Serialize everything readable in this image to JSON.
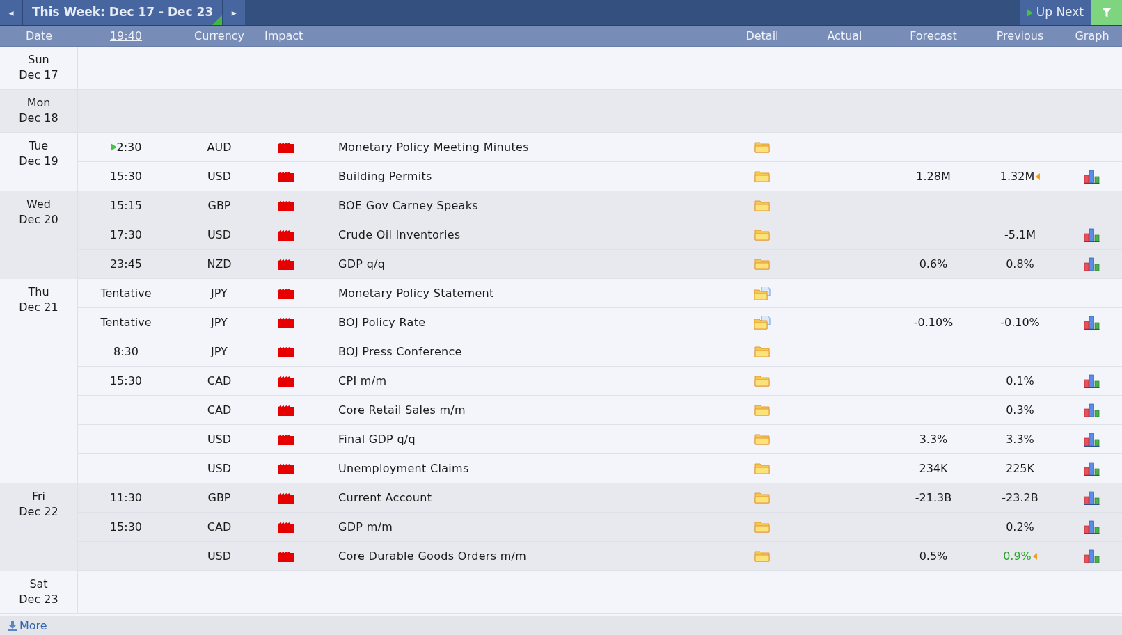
{
  "toolbar": {
    "prev_label": "◂",
    "week_label": "This Week: Dec 17 - Dec 23",
    "next_label": "▸",
    "up_next_label": "Up Next"
  },
  "columns": {
    "date": "Date",
    "time": "19:40",
    "currency": "Currency",
    "impact": "Impact",
    "detail": "Detail",
    "actual": "Actual",
    "forecast": "Forecast",
    "previous": "Previous",
    "graph": "Graph"
  },
  "days": [
    {
      "weekday": "Sun",
      "date": "Dec 17"
    },
    {
      "weekday": "Mon",
      "date": "Dec 18"
    },
    {
      "weekday": "Tue",
      "date": "Dec 19",
      "events": [
        {
          "time": "2:30",
          "up_next": true,
          "currency": "AUD",
          "color": "#e60000",
          "event": "Monetary Policy Meeting Minutes",
          "detail_document": false,
          "graph": false
        },
        {
          "time": "15:30",
          "up_next": false,
          "currency": "USD",
          "color": "#e60000",
          "event": "Building Permits",
          "detail_document": false,
          "forecast": "1.28M",
          "previous": "1.32M",
          "revised": true,
          "previous_better": false,
          "graph": true
        }
      ]
    },
    {
      "weekday": "Wed",
      "date": "Dec 20",
      "events": [
        {
          "time": "15:15",
          "up_next": false,
          "currency": "GBP",
          "color": "#e60000",
          "event": "BOE Gov Carney Speaks",
          "detail_document": false,
          "graph": false
        },
        {
          "time": "17:30",
          "up_next": false,
          "currency": "USD",
          "color": "#e60000",
          "event": "Crude Oil Inventories",
          "detail_document": false,
          "previous": "-5.1M",
          "revised": false,
          "previous_better": false,
          "graph": true
        },
        {
          "time": "23:45",
          "up_next": false,
          "currency": "NZD",
          "color": "#e60000",
          "event": "GDP q/q",
          "detail_document": false,
          "forecast": "0.6%",
          "previous": "0.8%",
          "revised": false,
          "previous_better": false,
          "graph": true
        }
      ]
    },
    {
      "weekday": "Thu",
      "date": "Dec 21",
      "events": [
        {
          "time": "Tentative",
          "up_next": false,
          "currency": "JPY",
          "color": "#e60000",
          "event": "Monetary Policy Statement",
          "detail_document": true,
          "graph": false
        },
        {
          "time": "Tentative",
          "up_next": false,
          "currency": "JPY",
          "color": "#e60000",
          "event": "BOJ Policy Rate",
          "detail_document": true,
          "forecast": "-0.10%",
          "previous": "-0.10%",
          "revised": false,
          "previous_better": false,
          "graph": true
        },
        {
          "time": "8:30",
          "up_next": false,
          "currency": "JPY",
          "color": "#e60000",
          "event": "BOJ Press Conference",
          "detail_document": false,
          "graph": false
        },
        {
          "time": "15:30",
          "up_next": false,
          "currency": "CAD",
          "color": "#e60000",
          "event": "CPI m/m",
          "detail_document": false,
          "previous": "0.1%",
          "revised": false,
          "previous_better": false,
          "graph": true
        },
        {
          "up_next": false,
          "currency": "CAD",
          "color": "#e60000",
          "event": "Core Retail Sales m/m",
          "detail_document": false,
          "previous": "0.3%",
          "revised": false,
          "previous_better": false,
          "graph": true
        },
        {
          "up_next": false,
          "currency": "USD",
          "color": "#e60000",
          "event": "Final GDP q/q",
          "detail_document": false,
          "forecast": "3.3%",
          "previous": "3.3%",
          "revised": false,
          "previous_better": false,
          "graph": true
        },
        {
          "up_next": false,
          "currency": "USD",
          "color": "#e60000",
          "event": "Unemployment Claims",
          "detail_document": false,
          "forecast": "234K",
          "previous": "225K",
          "revised": false,
          "previous_better": false,
          "graph": true
        }
      ]
    },
    {
      "weekday": "Fri",
      "date": "Dec 22",
      "events": [
        {
          "time": "11:30",
          "up_next": false,
          "currency": "GBP",
          "color": "#e60000",
          "event": "Current Account",
          "detail_document": false,
          "forecast": "-21.3B",
          "previous": "-23.2B",
          "revised": false,
          "previous_better": false,
          "graph": true
        },
        {
          "time": "15:30",
          "up_next": false,
          "currency": "CAD",
          "color": "#e60000",
          "event": "GDP m/m",
          "detail_document": false,
          "previous": "0.2%",
          "revised": false,
          "previous_better": false,
          "graph": true
        },
        {
          "up_next": false,
          "currency": "USD",
          "color": "#e60000",
          "event": "Core Durable Goods Orders m/m",
          "detail_document": false,
          "forecast": "0.5%",
          "previous": "0.9%",
          "revised": true,
          "previous_better": true,
          "graph": true
        }
      ]
    },
    {
      "weekday": "Sat",
      "date": "Dec 23"
    }
  ],
  "more_label": "More"
}
